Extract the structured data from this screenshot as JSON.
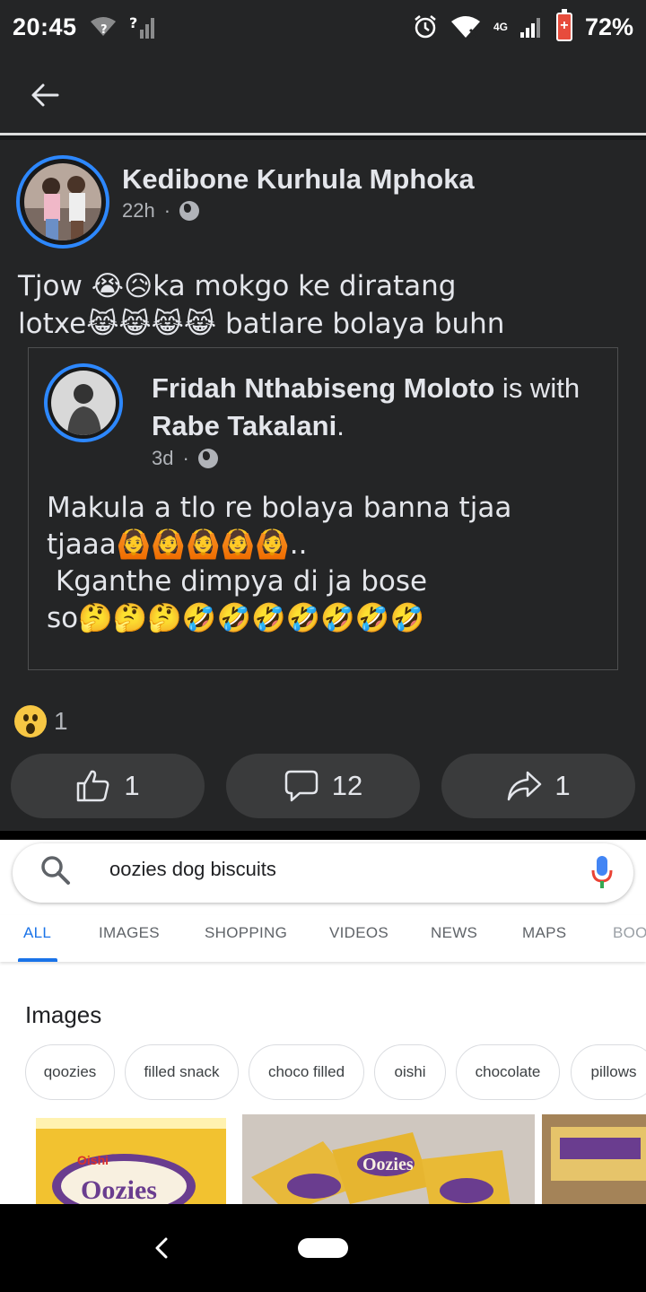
{
  "status_bar": {
    "time": "20:45",
    "network_4g": "4G",
    "battery": "72%",
    "icons": [
      "wifi-unknown-icon",
      "signal-unknown-icon",
      "alarm-icon",
      "wifi-icon",
      "signal-icon",
      "battery-saver-icon"
    ]
  },
  "app_bar": {
    "back_icon": "arrow-left-icon"
  },
  "post": {
    "author": "Kedibone Kurhula Mphoka",
    "time": "22h",
    "separator": "·",
    "privacy_icon": "globe-icon",
    "text_line1": "Tjow 😭😥ka mokgo ke diratang",
    "text_line2": "lotxe😹😹😹😹 batlare bolaya  buhn",
    "shared": {
      "author_name": "Fridah Nthabiseng Moloto",
      "with_text": " is with ",
      "tagged_name": "Rabe Takalani",
      "tagged_suffix": ".",
      "time": "3d",
      "separator": "·",
      "text": "Makula a tlo re bolaya banna tjaa\ntjaaa🙆🙆🙆🙆🙆..\n Kganthe dimpya di ja bose\nso🤔🤔🤔🤣🤣🤣🤣🤣🤣🤣"
    },
    "reactions": {
      "icon": "wow-emoji-icon",
      "count": "1"
    },
    "actions": {
      "like_count": "1",
      "comment_count": "12",
      "share_count": "1"
    }
  },
  "search_screenshot": {
    "query": "oozies dog biscuits",
    "tabs": [
      "ALL",
      "IMAGES",
      "SHOPPING",
      "VIDEOS",
      "NEWS",
      "MAPS",
      "BOO"
    ],
    "active_tab": "ALL",
    "images_heading": "Images",
    "chips": [
      "qoozies",
      "filled snack",
      "choco filled",
      "oishi",
      "chocolate",
      "pillows"
    ],
    "thumb1_brand": "Oishi",
    "thumb1_product": "Oozies",
    "thumb2_text": "Oozies",
    "colors": {
      "accent": "#1a73e8",
      "brand_yellow": "#f2c230",
      "brand_purple": "#6a3d8f"
    }
  },
  "nav_bar": {
    "back_icon": "nav-back-icon",
    "home_icon": "nav-home-pill-icon"
  }
}
